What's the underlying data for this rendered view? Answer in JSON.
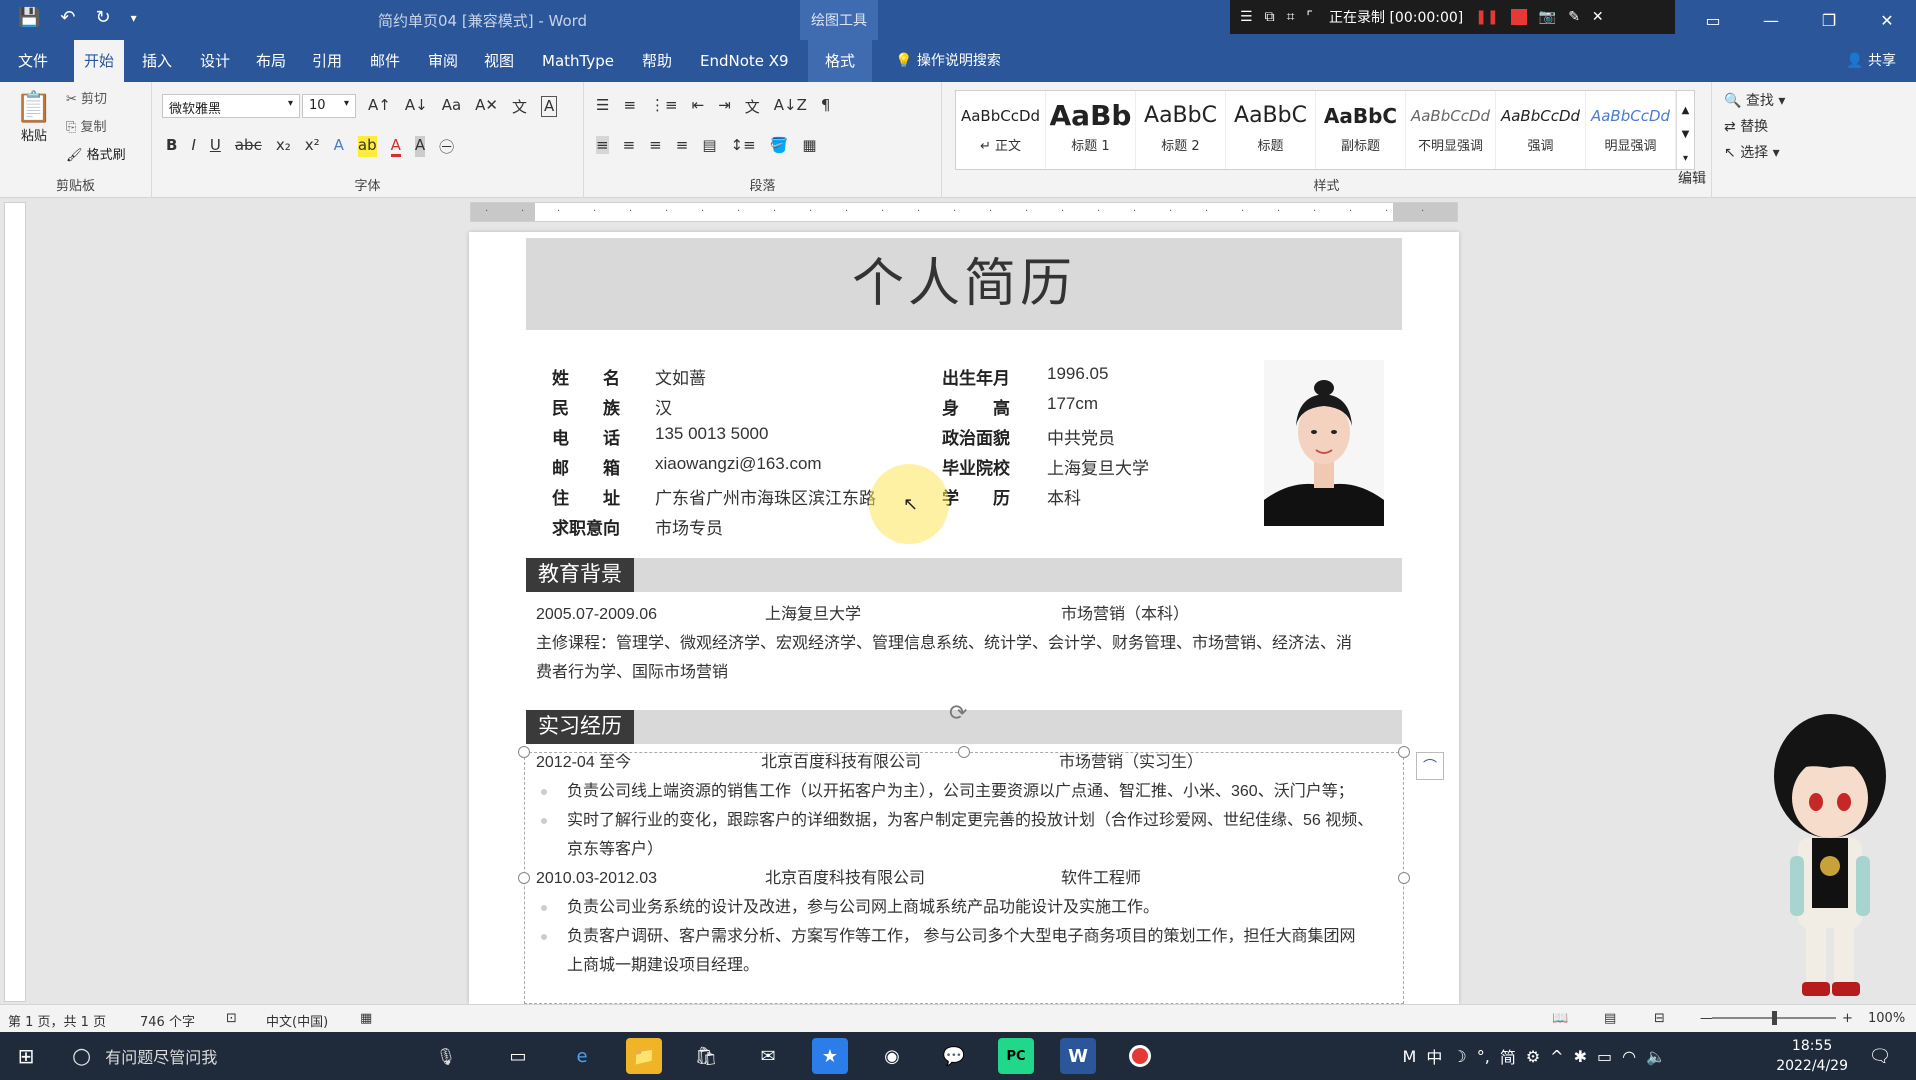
{
  "app": {
    "doc_title": "简约单页04 [兼容模式] - Word",
    "context_tools": "绘图工具",
    "recording_label": "正在录制 [00:00:00]"
  },
  "menu": {
    "tabs": [
      "文件",
      "开始",
      "插入",
      "设计",
      "布局",
      "引用",
      "邮件",
      "审阅",
      "视图",
      "MathType",
      "帮助",
      "EndNote X9",
      "格式"
    ],
    "search_hint": "操作说明搜索",
    "share": "共享"
  },
  "ribbon": {
    "clipboard": {
      "paste": "粘贴",
      "cut": "剪切",
      "copy": "复制",
      "format_painter": "格式刷",
      "label": "剪贴板"
    },
    "font": {
      "family": "微软雅黑",
      "size": "10",
      "label": "字体"
    },
    "paragraph": {
      "label": "段落"
    },
    "styles": {
      "label": "样式",
      "items": [
        {
          "preview": "AaBbCcDd",
          "name": "↵ 正文"
        },
        {
          "preview": "AaBb",
          "name": "标题 1"
        },
        {
          "preview": "AaBbC",
          "name": "标题 2"
        },
        {
          "preview": "AaBbC",
          "name": "标题"
        },
        {
          "preview": "AaBbC",
          "name": "副标题"
        },
        {
          "preview": "AaBbCcDd",
          "name": "不明显强调"
        },
        {
          "preview": "AaBbCcDd",
          "name": "强调"
        },
        {
          "preview": "AaBbCcDd",
          "name": "明显强调"
        }
      ]
    },
    "editing": {
      "find": "查找",
      "replace": "替换",
      "select": "选择",
      "label": "编辑"
    }
  },
  "document": {
    "title": "个人简历",
    "info_left": [
      {
        "label": "姓　　名",
        "value": "文如蔷"
      },
      {
        "label": "民　　族",
        "value": "汉"
      },
      {
        "label": "电　　话",
        "value": "135 0013 5000"
      },
      {
        "label": "邮　　箱",
        "value": "xiaowangzi@163.com"
      },
      {
        "label": "住　　址",
        "value": "广东省广州市海珠区滨江东路"
      },
      {
        "label": "求职意向",
        "value": "市场专员"
      }
    ],
    "info_right": [
      {
        "label": "出生年月",
        "value": "1996.05"
      },
      {
        "label": "身　　高",
        "value": "177cm"
      },
      {
        "label": "政治面貌",
        "value": "中共党员"
      },
      {
        "label": "毕业院校",
        "value": "上海复旦大学"
      },
      {
        "label": "学　　历",
        "value": "本科"
      }
    ],
    "education": {
      "heading": "教育背景",
      "period": "2005.07-2009.06",
      "school": "上海复旦大学",
      "major": "市场营销（本科）",
      "courses_line1": "主修课程：管理学、微观经济学、宏观经济学、管理信息系统、统计学、会计学、财务管理、市场营销、经济法、消",
      "courses_line2": "费者行为学、国际市场营销"
    },
    "internship": {
      "heading": "实习经历",
      "entries": [
        {
          "period": "2012-04 至今",
          "company": "北京百度科技有限公司",
          "role": "市场营销（实习生）",
          "bullets": [
            "负责公司线上端资源的销售工作（以开拓客户为主），公司主要资源以广点通、智汇推、小米、360、沃门户等；",
            "实时了解行业的变化，跟踪客户的详细数据，为客户制定更完善的投放计划（合作过珍爱网、世纪佳缘、56 视频、",
            "京东等客户）"
          ]
        },
        {
          "period": "2010.03-2012.03",
          "company": "北京百度科技有限公司",
          "role": "软件工程师",
          "bullets": [
            "负责公司业务系统的设计及改进，参与公司网上商城系统产品功能设计及实施工作。",
            "负责客户调研、客户需求分析、方案写作等工作， 参与公司多个大型电子商务项目的策划工作，担任大商集团网",
            "上商城一期建设项目经理。"
          ]
        }
      ]
    }
  },
  "status": {
    "page": "第 1 页，共 1 页",
    "words": "746 个字",
    "language": "中文(中国)",
    "zoom": "100%"
  },
  "taskbar": {
    "search_placeholder": "有问题尽管问我",
    "time": "18:55",
    "date": "2022/4/29",
    "ime": "中",
    "ime_mode": "简"
  }
}
